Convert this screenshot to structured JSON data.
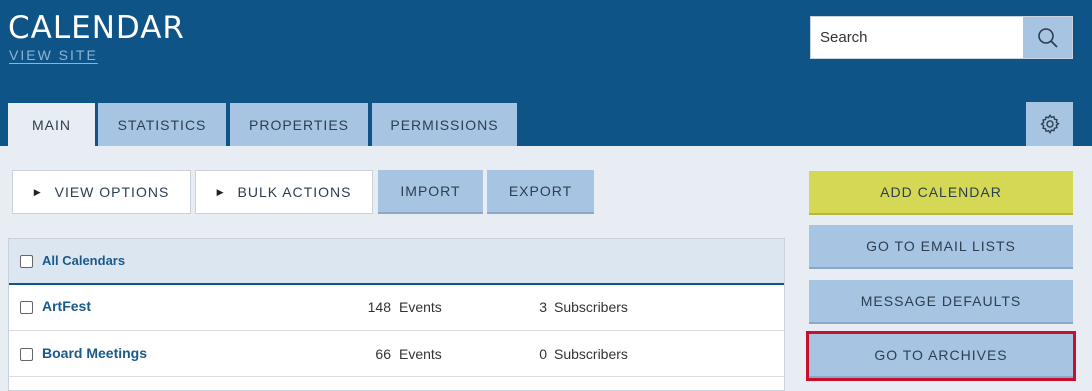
{
  "header": {
    "title": "CALENDAR",
    "view_site": "VIEW SITE",
    "search_placeholder": "Search"
  },
  "tabs": [
    {
      "label": "MAIN",
      "active": true
    },
    {
      "label": "STATISTICS",
      "active": false
    },
    {
      "label": "PROPERTIES",
      "active": false
    },
    {
      "label": "PERMISSIONS",
      "active": false
    }
  ],
  "toolbar": {
    "view_options": "VIEW OPTIONS",
    "bulk_actions": "BULK ACTIONS",
    "import": "IMPORT",
    "export": "EXPORT"
  },
  "table": {
    "select_all_label": "All Calendars",
    "rows": [
      {
        "name": "ArtFest",
        "events": "148",
        "events_label": "Events",
        "subscribers": "3",
        "subscribers_label": "Subscribers"
      },
      {
        "name": "Board Meetings",
        "events": "66",
        "events_label": "Events",
        "subscribers": "0",
        "subscribers_label": "Subscribers"
      }
    ]
  },
  "actions": {
    "add_calendar": "ADD CALENDAR",
    "email_lists": "GO TO EMAIL LISTS",
    "message_defaults": "MESSAGE DEFAULTS",
    "archives": "GO TO ARCHIVES"
  },
  "colors": {
    "header_bg": "#0e5486",
    "tab_bg": "#a8c4e3",
    "accent_lime": "#d4d855",
    "highlight_red": "#c8102e"
  },
  "icons": {
    "search": "search-icon",
    "settings": "gear-icon"
  }
}
